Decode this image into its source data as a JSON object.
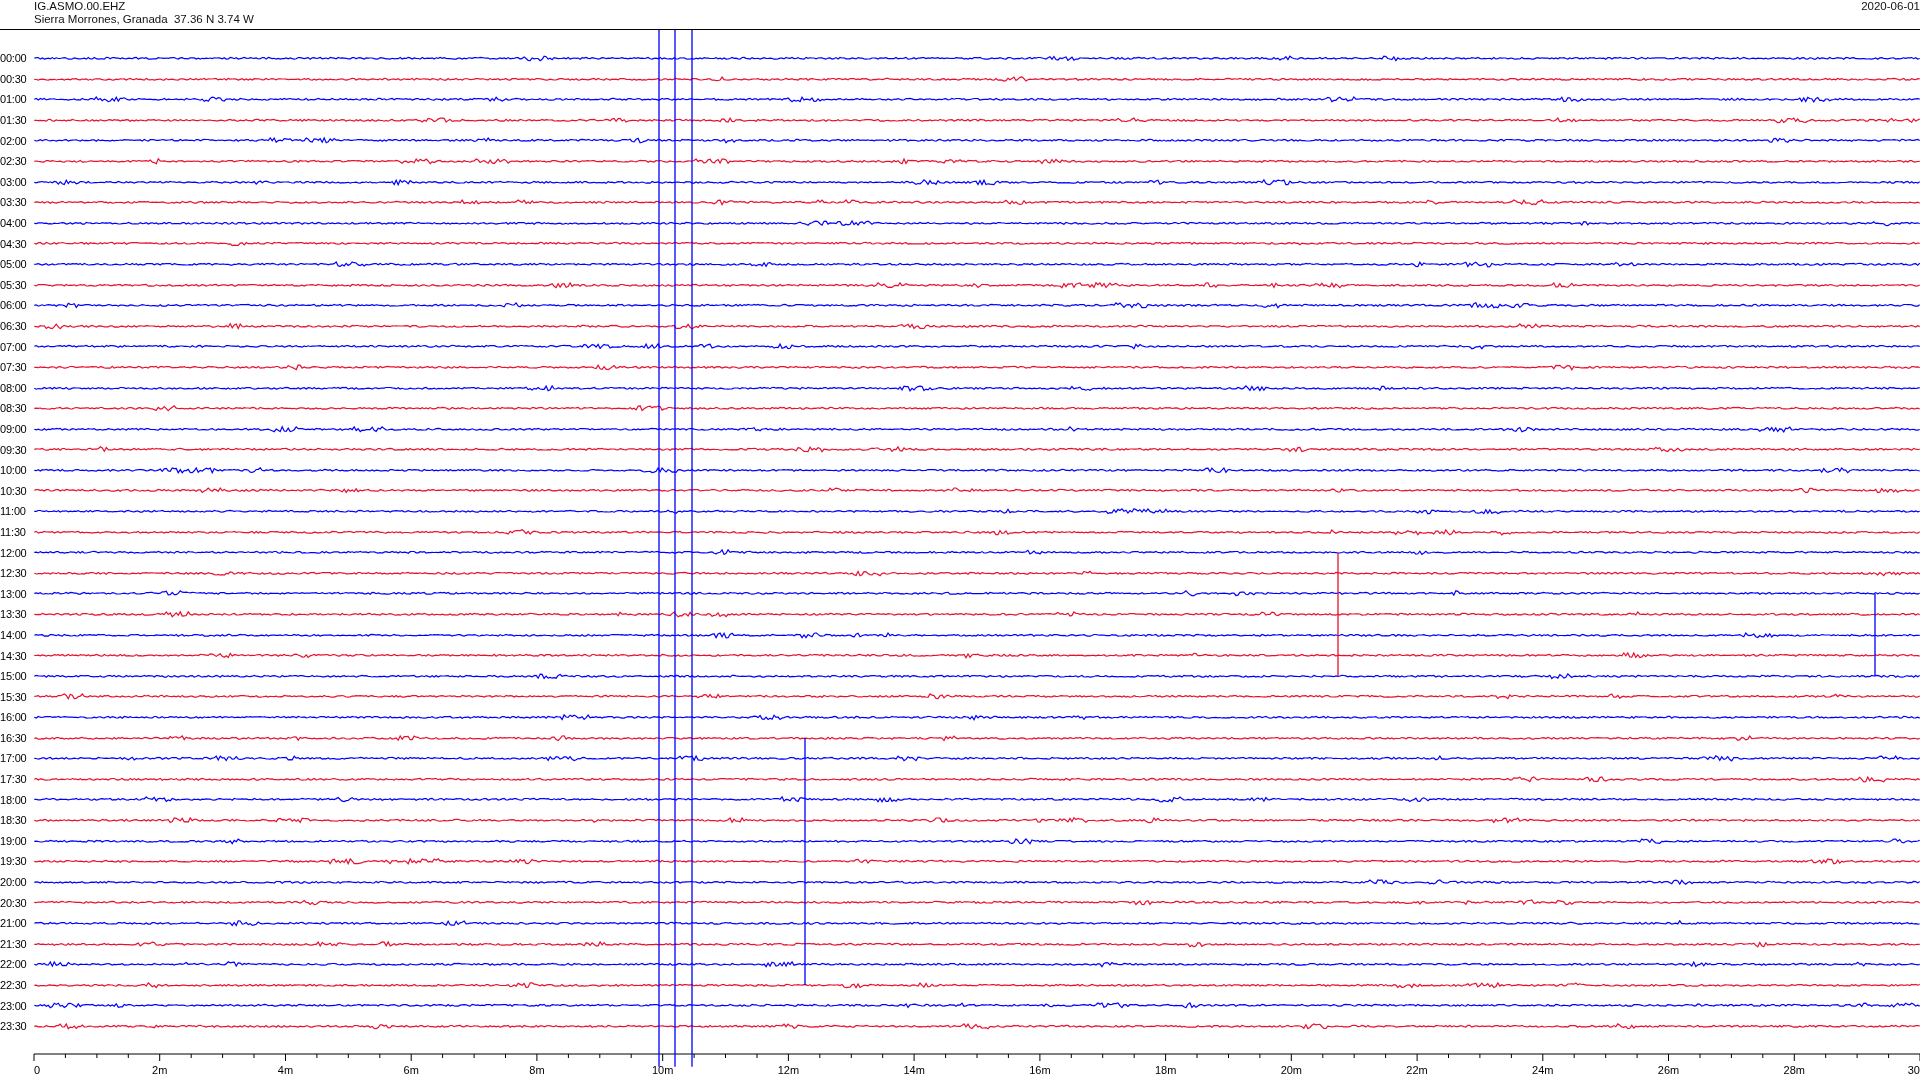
{
  "header": {
    "station": "IG.ASMO.00.EHZ",
    "location": "Sierra Morrones, Granada  37.36 N 3.74 W",
    "date": "2020-06-01"
  },
  "traces": [
    {
      "label": "00:00",
      "color": "#0000ff"
    },
    {
      "label": "00:30",
      "color": "#e8102e"
    },
    {
      "label": "01:00",
      "color": "#0000ff"
    },
    {
      "label": "01:30",
      "color": "#e8102e"
    },
    {
      "label": "02:00",
      "color": "#0000ff"
    },
    {
      "label": "02:30",
      "color": "#e8102e"
    },
    {
      "label": "03:00",
      "color": "#0000ff"
    },
    {
      "label": "03:30",
      "color": "#e8102e"
    },
    {
      "label": "04:00",
      "color": "#0000ff"
    },
    {
      "label": "04:30",
      "color": "#e8102e"
    },
    {
      "label": "05:00",
      "color": "#0000ff"
    },
    {
      "label": "05:30",
      "color": "#e8102e"
    },
    {
      "label": "06:00",
      "color": "#0000ff"
    },
    {
      "label": "06:30",
      "color": "#e8102e"
    },
    {
      "label": "07:00",
      "color": "#0000ff"
    },
    {
      "label": "07:30",
      "color": "#e8102e"
    },
    {
      "label": "08:00",
      "color": "#0000ff"
    },
    {
      "label": "08:30",
      "color": "#e8102e"
    },
    {
      "label": "09:00",
      "color": "#0000ff"
    },
    {
      "label": "09:30",
      "color": "#e8102e"
    },
    {
      "label": "10:00",
      "color": "#0000ff"
    },
    {
      "label": "10:30",
      "color": "#e8102e"
    },
    {
      "label": "11:00",
      "color": "#0000ff"
    },
    {
      "label": "11:30",
      "color": "#e8102e"
    },
    {
      "label": "12:00",
      "color": "#0000ff"
    },
    {
      "label": "12:30",
      "color": "#e8102e"
    },
    {
      "label": "13:00",
      "color": "#0000ff"
    },
    {
      "label": "13:30",
      "color": "#e8102e"
    },
    {
      "label": "14:00",
      "color": "#0000ff"
    },
    {
      "label": "14:30",
      "color": "#e8102e"
    },
    {
      "label": "15:00",
      "color": "#0000ff"
    },
    {
      "label": "15:30",
      "color": "#e8102e"
    },
    {
      "label": "16:00",
      "color": "#0000ff"
    },
    {
      "label": "16:30",
      "color": "#e8102e"
    },
    {
      "label": "17:00",
      "color": "#0000ff"
    },
    {
      "label": "17:30",
      "color": "#e8102e"
    },
    {
      "label": "18:00",
      "color": "#0000ff"
    },
    {
      "label": "18:30",
      "color": "#e8102e"
    },
    {
      "label": "19:00",
      "color": "#0000ff"
    },
    {
      "label": "19:30",
      "color": "#e8102e"
    },
    {
      "label": "20:00",
      "color": "#0000ff"
    },
    {
      "label": "20:30",
      "color": "#e8102e"
    },
    {
      "label": "21:00",
      "color": "#0000ff"
    },
    {
      "label": "21:30",
      "color": "#e8102e"
    },
    {
      "label": "22:00",
      "color": "#0000ff"
    },
    {
      "label": "22:30",
      "color": "#e8102e"
    },
    {
      "label": "23:00",
      "color": "#0000ff"
    },
    {
      "label": "23:30",
      "color": "#e8102e"
    }
  ],
  "axis": {
    "ticks": [
      "0",
      "2m",
      "4m",
      "6m",
      "8m",
      "10m",
      "12m",
      "14m",
      "16m",
      "18m",
      "20m",
      "22m",
      "24m",
      "26m",
      "28m",
      "30"
    ]
  }
}
